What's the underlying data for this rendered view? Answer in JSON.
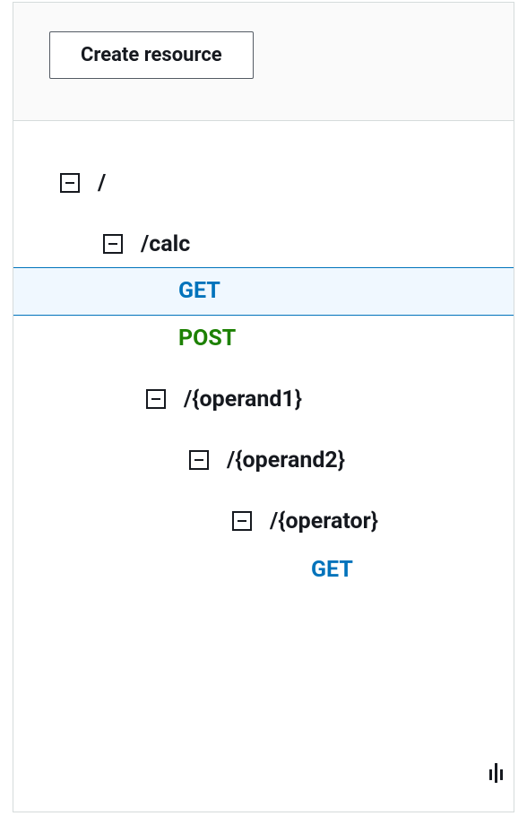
{
  "toolbar": {
    "create_resource_label": "Create resource"
  },
  "tree": {
    "root": {
      "label": "/"
    },
    "calc": {
      "label": "/calc"
    },
    "calc_get": {
      "label": "GET"
    },
    "calc_post": {
      "label": "POST"
    },
    "operand1": {
      "label": "/{operand1}"
    },
    "operand2": {
      "label": "/{operand2}"
    },
    "operator": {
      "label": "/{operator}"
    },
    "operator_get": {
      "label": "GET"
    }
  }
}
